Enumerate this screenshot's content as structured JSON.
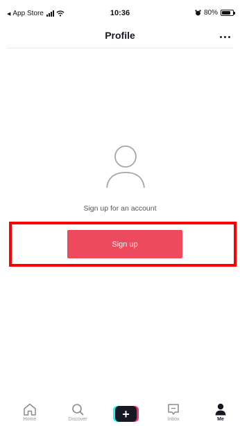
{
  "status_bar": {
    "back_app": "App Store",
    "time": "10:36",
    "battery_percent": "80%",
    "battery_level": 0.8
  },
  "header": {
    "title": "Profile",
    "more_icon": "more-horizontal-icon"
  },
  "profile": {
    "avatar_icon": "person-outline-icon",
    "prompt": "Sign up for an account",
    "signup_label": "Sign up"
  },
  "colors": {
    "accent": "#ee4a5e",
    "highlight": "#ff0000"
  },
  "tab_bar": {
    "items": [
      {
        "label": "Home",
        "icon": "home-icon",
        "active": false
      },
      {
        "label": "Discover",
        "icon": "search-icon",
        "active": false
      },
      {
        "label": "",
        "icon": "plus-icon",
        "active": false
      },
      {
        "label": "Inbox",
        "icon": "message-icon",
        "active": false
      },
      {
        "label": "Me",
        "icon": "person-filled-icon",
        "active": true
      }
    ]
  }
}
